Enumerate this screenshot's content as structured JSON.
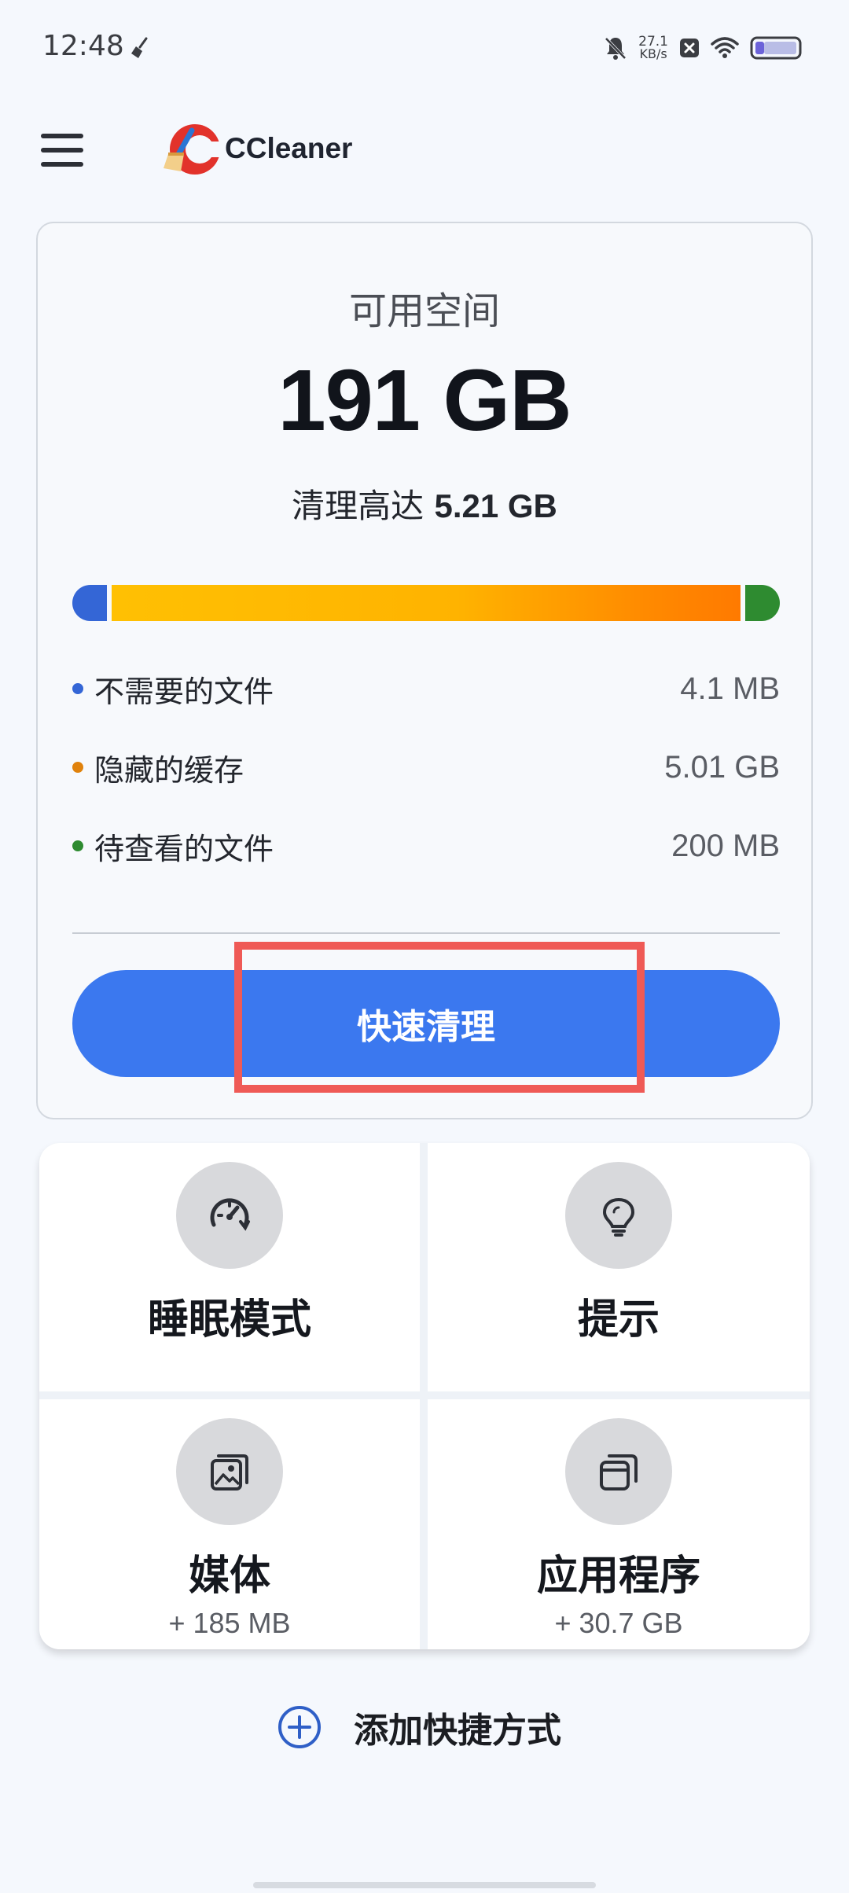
{
  "status_bar": {
    "time": "12:48",
    "speed_value": "27.1",
    "speed_unit": "KB/s",
    "icons": [
      "broom-icon",
      "bell-muted-icon",
      "x-box-icon",
      "wifi-icon",
      "battery-icon"
    ]
  },
  "header": {
    "app_name": "CCleaner"
  },
  "storage": {
    "available_label": "可用空间",
    "available_value": "191 GB",
    "clean_prefix": "清理高达",
    "clean_amount": "5.21 GB",
    "categories": [
      {
        "label": "不需要的文件",
        "value": "4.1 MB",
        "color": "#3466d6"
      },
      {
        "label": "隐藏的缓存",
        "value": "5.01 GB",
        "color": "#e0820c"
      },
      {
        "label": "待查看的文件",
        "value": "200 MB",
        "color": "#2e8b30"
      }
    ],
    "quick_clean_label": "快速清理"
  },
  "tiles": [
    {
      "title": "睡眠模式",
      "subtitle": "",
      "icon": "speedometer-icon"
    },
    {
      "title": "提示",
      "subtitle": "",
      "icon": "lightbulb-icon"
    },
    {
      "title": "媒体",
      "subtitle": "+ 185 MB",
      "icon": "gallery-icon"
    },
    {
      "title": "应用程序",
      "subtitle": "+ 30.7 GB",
      "icon": "apps-icon"
    }
  ],
  "add_shortcut_label": "添加快捷方式",
  "colors": {
    "accent": "#3b78ef",
    "highlight": "#ef5a56",
    "background": "#f5f8fd"
  }
}
